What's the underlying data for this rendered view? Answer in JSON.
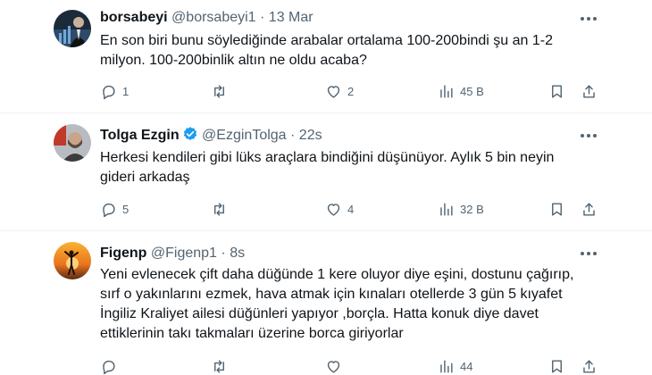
{
  "tweets": [
    {
      "name": "borsabeyi",
      "handle": "@borsabeyi1",
      "separator": "·",
      "time": "13 Mar",
      "verified": false,
      "text_lines": [
        "En son biri bunu söylediğinde arabalar ortalama 100-200bindi şu an 1-2",
        "milyon. 100-200binlik altın ne oldu acaba?"
      ],
      "replies": "1",
      "retweets": "",
      "likes": "2",
      "views": "45 B"
    },
    {
      "name": "Tolga Ezgin",
      "handle": "@EzginTolga",
      "separator": "·",
      "time": "22s",
      "verified": true,
      "text_lines": [
        "Herkesi kendileri gibi lüks araçlara bindiğini düşünüyor. Aylık 5 bin neyin",
        "gideri arkadaş"
      ],
      "replies": "5",
      "retweets": "",
      "likes": "4",
      "views": "32 B"
    },
    {
      "name": "Figenp",
      "handle": "@Figenp1",
      "separator": "·",
      "time": "8s",
      "verified": false,
      "text_lines": [
        "Yeni evlenecek çift daha düğünde 1 kere oluyor diye eşini, dostunu çağırıp,",
        "sırf o yakınlarını ezmek, hava atmak için kınaları otellerde 3 gün 5 kıyafet",
        "İngiliz Kraliyet ailesi düğünleri yapıyor ,borçla. Hatta konuk diye davet",
        "ettiklerinin takı takmaları üzerine borca giriyorlar"
      ],
      "replies": "",
      "retweets": "",
      "likes": "",
      "views": "44"
    }
  ],
  "colors": {
    "text": "#0f1419",
    "muted": "#536471",
    "verified": "#1d9bf0",
    "separator": "#eff3f4"
  },
  "icons": [
    "reply-icon",
    "retweet-icon",
    "like-icon",
    "views-icon",
    "bookmark-icon",
    "share-icon",
    "more-icon",
    "verified-badge-icon"
  ]
}
